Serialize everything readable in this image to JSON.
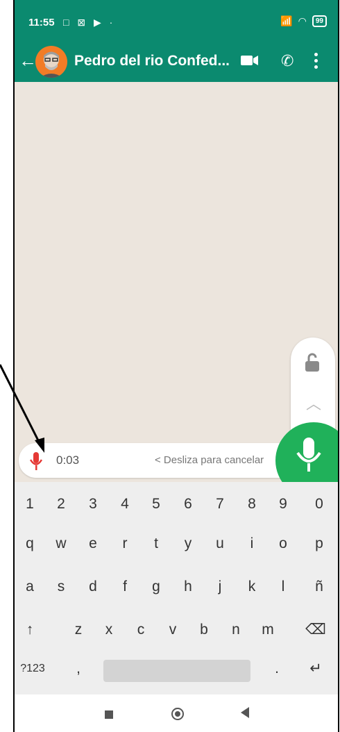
{
  "status_bar": {
    "time": "11:55",
    "icons": "□ ⊠ ▶ ·",
    "battery": "99"
  },
  "app_bar": {
    "title": "Pedro del rio Confed..."
  },
  "recording": {
    "timer": "0:03",
    "slide_hint": "< Desliza para cancelar"
  },
  "keyboard": {
    "numbers": [
      "1",
      "2",
      "3",
      "4",
      "5",
      "6",
      "7",
      "8",
      "9",
      "0"
    ],
    "row1": [
      "q",
      "w",
      "e",
      "r",
      "t",
      "y",
      "u",
      "i",
      "o",
      "p"
    ],
    "row2": [
      "a",
      "s",
      "d",
      "f",
      "g",
      "h",
      "j",
      "k",
      "l",
      "ñ"
    ],
    "row3": [
      "↑",
      "z",
      "x",
      "c",
      "v",
      "b",
      "n",
      "m",
      "⌫"
    ],
    "row4": [
      "?123",
      ",",
      "",
      ".",
      "↵"
    ]
  },
  "colors": {
    "header": "#0b8a6f",
    "mic": "#20b15a",
    "recording_mic": "#e53935"
  }
}
